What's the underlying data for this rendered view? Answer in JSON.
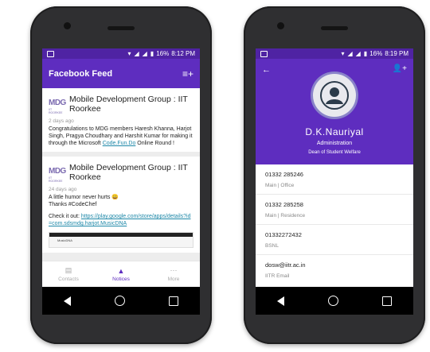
{
  "left_phone": {
    "status": {
      "battery": "16%",
      "time": "8:12 PM"
    },
    "appbar": {
      "title": "Facebook Feed",
      "menu_icon": "playlist-add-icon"
    },
    "posts": [
      {
        "logo_text": "MDG",
        "logo_sub": "IIT ROORKEE",
        "title": "Mobile Development Group : IIT Roorkee",
        "time": "2 days ago",
        "body": "Congratulations to MDG members Haresh Khanna, Harjot Singh, Pragya Choudhary and Harshit Kumar for making it through the Microsoft ",
        "link": "Code.Fun.Do",
        "body_after": " Online Round !"
      },
      {
        "logo_text": "MDG",
        "logo_sub": "IIT ROORKEE",
        "title": "Mobile Development Group : IIT Roorkee",
        "time": "24 days ago",
        "body_line1": "A little humor never hurts 😀",
        "body_line2": "Thanks #CodeChef",
        "body_check": "Check it out: ",
        "link": "https://play.google.com/store/apps/details?id=com.sdsmdg.harjot.MusicDNA",
        "preview_label": "MusicDNA"
      }
    ],
    "bottom_nav": [
      {
        "label": "Contacts",
        "icon": "contacts-icon",
        "active": false
      },
      {
        "label": "Notices",
        "icon": "bell-icon",
        "active": true
      },
      {
        "label": "More",
        "icon": "more-icon",
        "active": false
      }
    ]
  },
  "right_phone": {
    "status": {
      "battery": "16%",
      "time": "8:19 PM"
    },
    "profile": {
      "name": "D.K.Nauriyal",
      "role": "Administration",
      "dept": "Dean of Student Welfare"
    },
    "contacts": [
      {
        "value": "01332 285246",
        "label": "Main | Office"
      },
      {
        "value": "01332 285258",
        "label": "Main | Residence"
      },
      {
        "value": "01332272432",
        "label": "BSNL"
      },
      {
        "value": "dosw@iitr.ac.in",
        "label": "IITR Email"
      }
    ]
  },
  "colors": {
    "accent": "#5e2dbf",
    "statusbar": "#4f23a3",
    "link": "#1e88a8"
  }
}
